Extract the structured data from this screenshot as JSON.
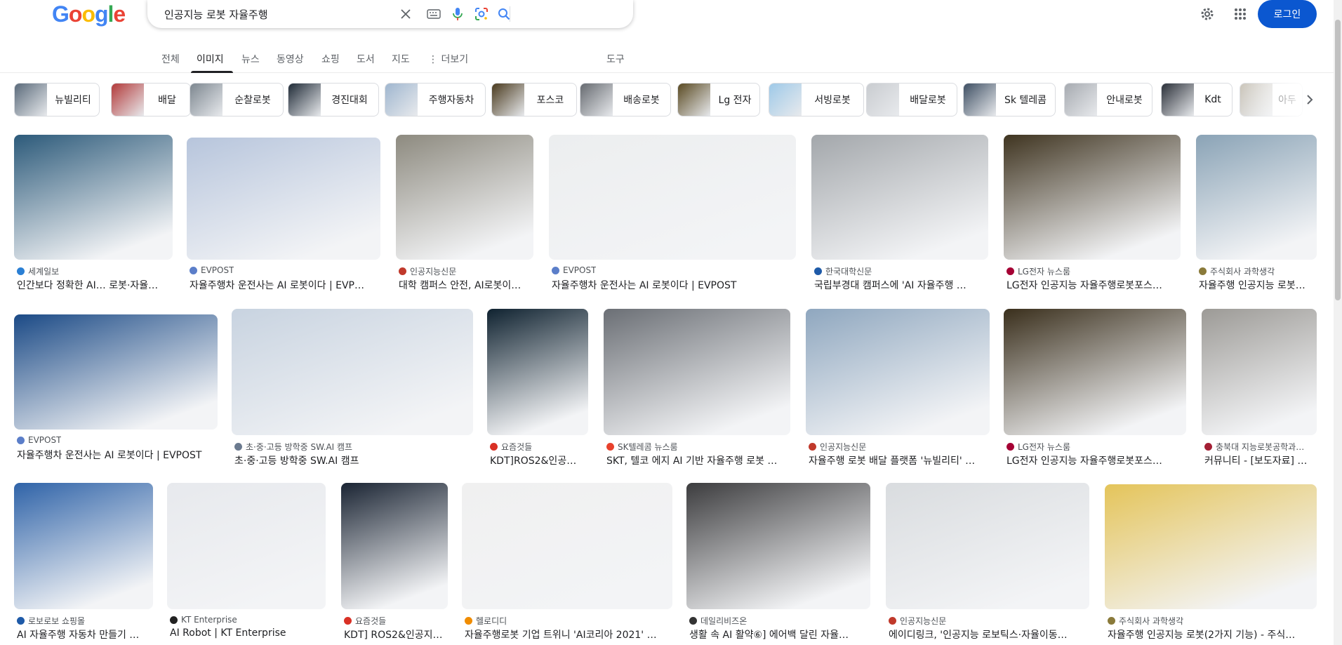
{
  "logo": {
    "letters": [
      "G",
      "o",
      "o",
      "g",
      "l",
      "e"
    ],
    "colors": [
      "#4285F4",
      "#EA4335",
      "#FBBC05",
      "#4285F4",
      "#34A853",
      "#EA4335"
    ]
  },
  "search": {
    "query": "인공지능 로봇 자율주행"
  },
  "header": {
    "login_label": "로그인"
  },
  "tabs": [
    {
      "label": "전체",
      "active": false
    },
    {
      "label": "이미지",
      "active": true
    },
    {
      "label": "뉴스",
      "active": false
    },
    {
      "label": "동영상",
      "active": false
    },
    {
      "label": "쇼핑",
      "active": false
    },
    {
      "label": "도서",
      "active": false
    },
    {
      "label": "지도",
      "active": false
    },
    {
      "label": "⋮ 더보기",
      "active": false
    }
  ],
  "tools_label": "도구",
  "chips": [
    {
      "label": "뉴빌리티",
      "color": "#5a6a7a"
    },
    {
      "label": "배달",
      "color": "#b23a3a"
    },
    {
      "label": "순찰로봇",
      "color": "#7d8790"
    },
    {
      "label": "경진대회",
      "color": "#1f2a36"
    },
    {
      "label": "주행자동차",
      "color": "#9fb6cf"
    },
    {
      "label": "포스코",
      "color": "#4a3a1e"
    },
    {
      "label": "배송로봇",
      "color": "#666a70"
    },
    {
      "label": "Lg 전자",
      "color": "#5a4a22"
    },
    {
      "label": "서빙로봇",
      "color": "#9ec9e8"
    },
    {
      "label": "배달로봇",
      "color": "#c9ccd0"
    },
    {
      "label": "Sk 텔레콤",
      "color": "#3e4f63"
    },
    {
      "label": "안내로봇",
      "color": "#a6aab0"
    },
    {
      "label": "Kdt",
      "color": "#2a2f38"
    },
    {
      "label": "아두",
      "color": "#c6c0b4"
    }
  ],
  "results": [
    {
      "source": "세계일보",
      "title": "인간보다 정확한 AI… 로봇·자율…",
      "color": "#2c5a7a",
      "fav": "#2a7fd4"
    },
    {
      "source": "EVPOST",
      "title": "자율주행차 운전사는 AI 로봇이다 | EVP…",
      "color": "#b7c5dc",
      "fav": "#5b7ec9"
    },
    {
      "source": "인공지능신문",
      "title": "대학 캠퍼스 안전, AI로봇이…",
      "color": "#8d8a7f",
      "fav": "#c0392b"
    },
    {
      "source": "EVPOST",
      "title": "자율주행차 운전사는 AI 로봇이다 | EVPOST",
      "color": "#eceeef",
      "fav": "#5b7ec9"
    },
    {
      "source": "한국대학신문",
      "title": "국립부경대 캠퍼스에 'AI 자율주행 …",
      "color": "#a3a7ab",
      "fav": "#1e5aa8"
    },
    {
      "source": "LG전자 뉴스룸",
      "title": "LG전자 인공지능 자율주행로봇포스…",
      "color": "#3f3420",
      "fav": "#a50034"
    },
    {
      "source": "주식회사 과학생각",
      "title": "자율주행 인공지능 로봇…",
      "color": "#8aa3b6",
      "fav": "#8a7a3a"
    },
    {
      "source": "EVPOST",
      "title": "자율주행차 운전사는 AI 로봇이다 | EVPOST",
      "color": "#1b4a86",
      "fav": "#5b7ec9"
    },
    {
      "source": "초·중·고등 방학중 SW.AI 캠프",
      "title": "초·중·고등 방학중 SW.AI 캠프",
      "color": "#c8d3e0",
      "fav": "#6b7a8f"
    },
    {
      "source": "요즘것들",
      "title": "KDT]ROS2&인공…",
      "color": "#0f2230",
      "fav": "#d93025"
    },
    {
      "source": "SK텔레콤 뉴스룸",
      "title": "SKT, 텔코 에지 AI 기반 자율주행 로봇 …",
      "color": "#6b6f75",
      "fav": "#e8412c"
    },
    {
      "source": "인공지능신문",
      "title": "자율주행 로봇 배달 플랫폼 '뉴빌리티' …",
      "color": "#8fa7bf",
      "fav": "#c0392b"
    },
    {
      "source": "LG전자 뉴스룸",
      "title": "LG전자 인공지능 자율주행로봇포스…",
      "color": "#3a2f1c",
      "fav": "#a50034"
    },
    {
      "source": "충북대 지능로봇공학과…",
      "title": "커뮤니티 - [보도자료] …",
      "color": "#9c9a96",
      "fav": "#a31f34"
    },
    {
      "source": "로보로보 쇼핑몰",
      "title": "AI 자율주행 자동차 만들기 …",
      "color": "#2f63a8",
      "fav": "#1e5aa8"
    },
    {
      "source": "KT Enterprise",
      "title": "AI Robot | KT Enterprise",
      "color": "#e7e9ed",
      "fav": "#222222"
    },
    {
      "source": "요즘것들",
      "title": "KDT] ROS2&인공지…",
      "color": "#1a2433",
      "fav": "#d93025"
    },
    {
      "source": "헬로디디",
      "title": "자율주행로봇 기업 트위니 'AI코리아 2021' …",
      "color": "#f0f0f0",
      "fav": "#f08c00"
    },
    {
      "source": "데일리비즈온",
      "title": "생활 속 AI 활약⑥] 에어백 달린 자율…",
      "color": "#3c3c3e",
      "fav": "#333333"
    },
    {
      "source": "인공지능신문",
      "title": "에이디링크, '인공지능 로보틱스·자율이동…",
      "color": "#d9dcdf",
      "fav": "#c0392b"
    },
    {
      "source": "주식회사 과학생각",
      "title": "자율주행 인공지능 로봇(2가지 기능) - 주식…",
      "color": "#e4c45a",
      "fav": "#8a7a3a"
    }
  ]
}
